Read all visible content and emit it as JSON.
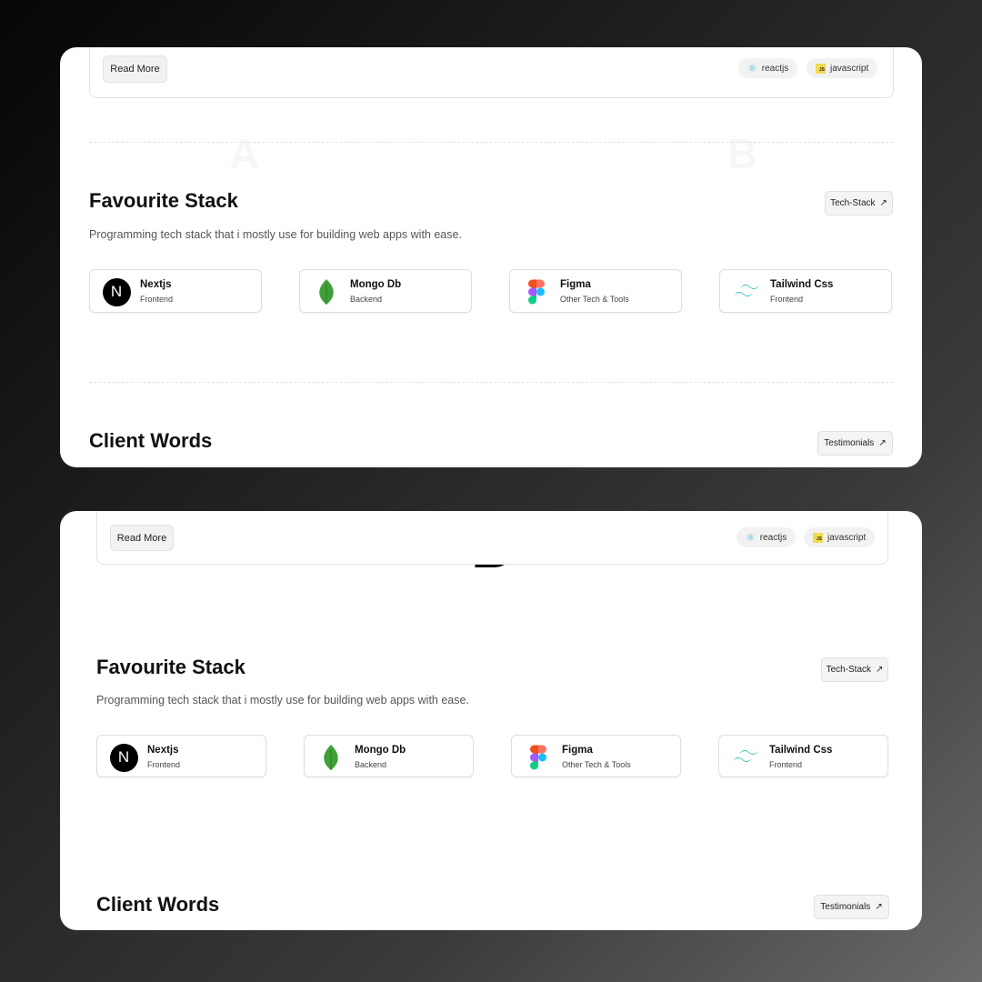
{
  "panels": [
    {
      "label": "A",
      "project_card": {
        "read_more": "Read More",
        "tags": [
          {
            "label": "reactjs",
            "icon": "react-icon",
            "icon_color": "#4fc3e8"
          },
          {
            "label": "javascript",
            "icon": "javascript-icon",
            "icon_color": "#f0db4f"
          }
        ]
      },
      "stack": {
        "title": "Favourite Stack",
        "description": "Programming tech stack that i mostly use for building web apps with ease.",
        "button": "Tech-Stack",
        "items": [
          {
            "name": "Nextjs",
            "category": "Frontend",
            "icon": "nextjs-icon"
          },
          {
            "name": "Mongo Db",
            "category": "Backend",
            "icon": "mongodb-icon"
          },
          {
            "name": "Figma",
            "category": "Other Tech & Tools",
            "icon": "figma-icon"
          },
          {
            "name": "Tailwind Css",
            "category": "Frontend",
            "icon": "tailwind-icon"
          }
        ]
      },
      "client": {
        "title": "Client Words",
        "button": "Testimonials"
      }
    },
    {
      "label": "B",
      "project_card": {
        "read_more": "Read More",
        "tags": [
          {
            "label": "reactjs",
            "icon": "react-icon",
            "icon_color": "#4fc3e8"
          },
          {
            "label": "javascript",
            "icon": "javascript-icon",
            "icon_color": "#f0db4f"
          }
        ]
      },
      "stack": {
        "title": "Favourite Stack",
        "description": "Programming tech stack that i mostly use for building web apps with ease.",
        "button": "Tech-Stack",
        "items": [
          {
            "name": "Nextjs",
            "category": "Frontend",
            "icon": "nextjs-icon"
          },
          {
            "name": "Mongo Db",
            "category": "Backend",
            "icon": "mongodb-icon"
          },
          {
            "name": "Figma",
            "category": "Other Tech & Tools",
            "icon": "figma-icon"
          },
          {
            "name": "Tailwind Css",
            "category": "Frontend",
            "icon": "tailwind-icon"
          }
        ]
      },
      "client": {
        "title": "Client Words",
        "button": "Testimonials"
      }
    }
  ],
  "arrow_glyph": "↗",
  "colors": {
    "mongodb_green": "#3fa037",
    "tailwind_teal": "#38bdb5",
    "react_blue": "#4fc3e8",
    "js_yellow": "#f0db4f"
  }
}
